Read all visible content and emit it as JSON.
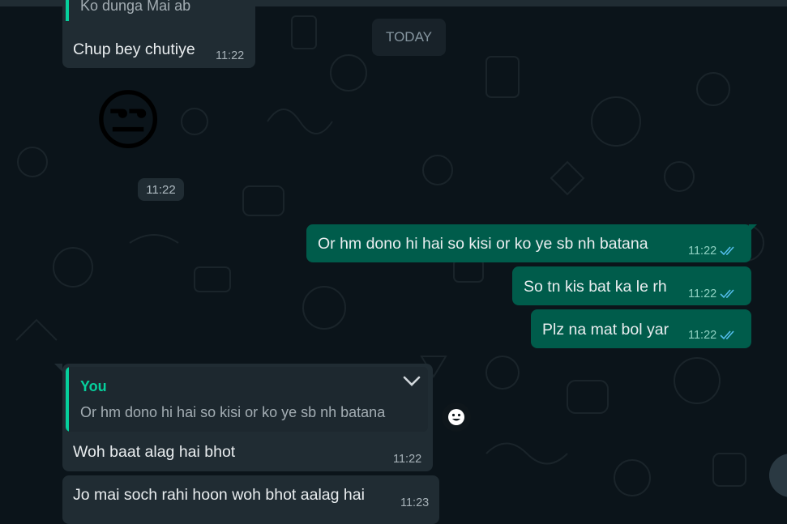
{
  "date_divider": "TODAY",
  "sticker": {
    "emoji": "😒",
    "time": "11:22",
    "icon": "unamused-face-sticker"
  },
  "messages": [
    {
      "id": "m1",
      "direction": "incoming",
      "quote_fragment": "Ko dunga Mai ab",
      "text": "Chup bey chutiye",
      "time": "11:22"
    },
    {
      "id": "m2",
      "direction": "outgoing",
      "text": "Or hm dono hi hai so kisi or ko ye sb nh batana",
      "time": "11:22",
      "status": "read"
    },
    {
      "id": "m3",
      "direction": "outgoing",
      "text": "So tn kis bat ka le rh",
      "time": "11:22",
      "status": "read"
    },
    {
      "id": "m4",
      "direction": "outgoing",
      "text": "Plz na mat bol yar",
      "time": "11:22",
      "status": "read"
    },
    {
      "id": "m5",
      "direction": "incoming",
      "quoted": {
        "author": "You",
        "text": "Or hm dono hi hai so kisi or ko ye sb nh batana"
      },
      "text": "Woh baat alag hai bhot",
      "time": "11:22"
    },
    {
      "id": "m6",
      "direction": "incoming",
      "text": "Jo mai soch rahi hoon woh bhot aalag hai",
      "time": "11:23"
    }
  ],
  "icons": {
    "read_ticks": "double-check-icon",
    "message_menu": "chevron-down-icon",
    "react": "smiley-icon",
    "scroll": "scroll-down-button"
  },
  "colors": {
    "background": "#0b141a",
    "incoming_bubble": "#202c33",
    "outgoing_bubble": "#005c4b",
    "accent": "#06cf9c",
    "read_tick": "#53bdeb"
  }
}
